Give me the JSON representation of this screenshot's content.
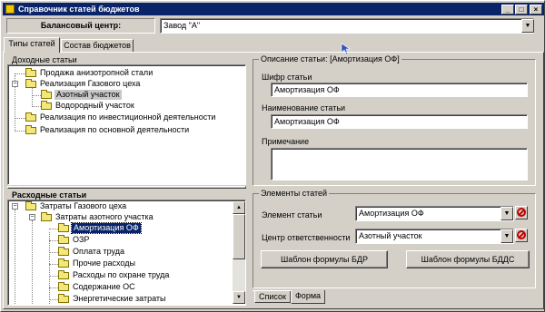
{
  "window": {
    "title": "Справочник статей бюджетов"
  },
  "balance_center": {
    "label": "Балансовый центр:",
    "value": "Завод \"А\""
  },
  "tabs_main": [
    {
      "label": "Типы статей"
    },
    {
      "label": "Состав бюджетов"
    }
  ],
  "income": {
    "title": "Доходные статьи",
    "items": [
      {
        "label": "Продажа анизотропной стали"
      },
      {
        "label": "Реализация Газового цеха"
      },
      {
        "label": "Азотный участок"
      },
      {
        "label": "Водородный участок"
      },
      {
        "label": "Реализация по инвестиционной деятельности"
      },
      {
        "label": "Реализация по основной деятельности"
      }
    ]
  },
  "expense": {
    "title": "Расходные статьи",
    "items": [
      {
        "label": "Затраты Газового цеха"
      },
      {
        "label": "Затраты азотного участка"
      },
      {
        "label": "Амортизация ОФ"
      },
      {
        "label": "ОЗР"
      },
      {
        "label": "Оплата труда"
      },
      {
        "label": "Прочие расходы"
      },
      {
        "label": "Расходы по охране труда"
      },
      {
        "label": "Содержание ОС"
      },
      {
        "label": "Энергетические затраты"
      }
    ]
  },
  "description": {
    "title": "Описание статьи: [Амортизация ОФ]",
    "code_label": "Шифр статьи",
    "code_value": "Амортизация ОФ",
    "name_label": "Наименование статьи",
    "name_value": "Амортизация ОФ",
    "note_label": "Примечание",
    "note_value": ""
  },
  "elements": {
    "title": "Элементы статей",
    "element_label": "Элемент статьи",
    "element_value": "Амортизация ОФ",
    "center_label": "Центр ответственности",
    "center_value": "Азотный участок",
    "bdr_button": "Шаблон формулы БДР",
    "bdds_button": "Шаблон формулы БДДС"
  },
  "tabs_bottom": [
    {
      "label": "Список"
    },
    {
      "label": "Форма"
    }
  ]
}
